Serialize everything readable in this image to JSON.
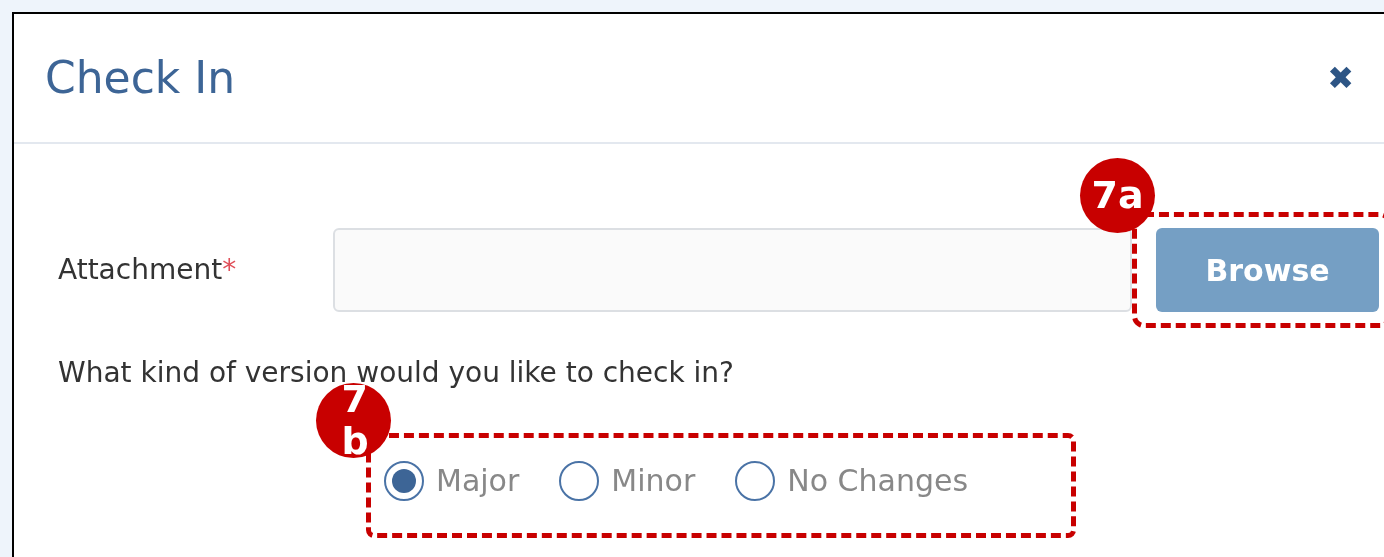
{
  "dialog": {
    "title": "Check In",
    "close": "✖"
  },
  "attachment": {
    "label": "Attachment",
    "required_mark": "*"
  },
  "browse_button": "Browse",
  "question": "What kind of version would you like to check in?",
  "version_options": [
    {
      "label": "Major",
      "selected": true
    },
    {
      "label": "Minor",
      "selected": false
    },
    {
      "label": "No Changes",
      "selected": false
    }
  ],
  "callouts": [
    {
      "label": "7a"
    },
    {
      "label": "7b"
    }
  ]
}
